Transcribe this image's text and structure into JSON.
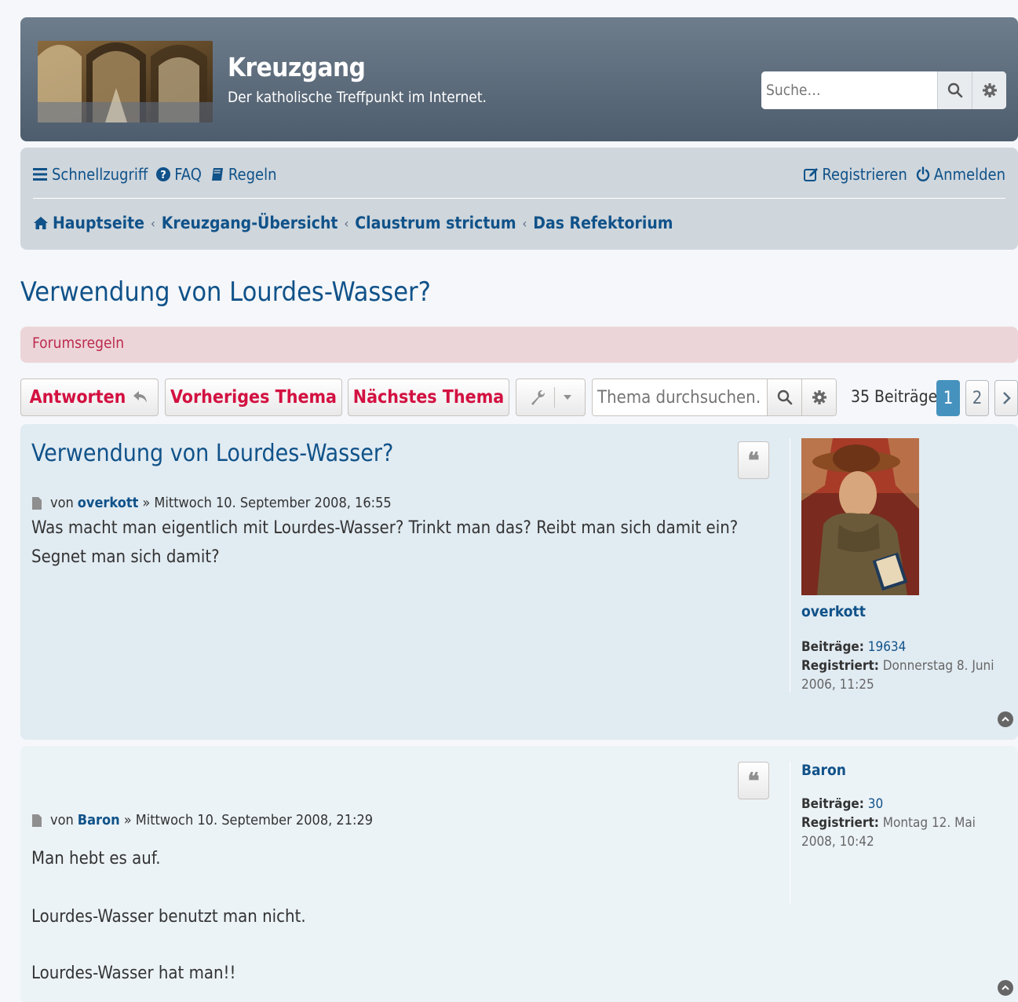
{
  "site": {
    "title": "Kreuzgang",
    "description": "Der katholische Treffpunkt im Internet.",
    "search_placeholder": "Suche…"
  },
  "nav": {
    "quicklinks": "Schnellzugriff",
    "faq": "FAQ",
    "rules": "Regeln",
    "register": "Registrieren",
    "login": "Anmelden"
  },
  "breadcrumbs": [
    "Hauptseite",
    "Kreuzgang-Übersicht",
    "Claustrum strictum",
    "Das Refektorium"
  ],
  "topic": {
    "title": "Verwendung von Lourdes-Wasser?",
    "forum_rules": "Forumsregeln"
  },
  "actions": {
    "reply": "Antworten",
    "prev": "Vorheriges Thema",
    "next": "Nächstes Thema",
    "search_placeholder": "Thema durchsuchen…",
    "post_count": "35 Beiträge",
    "pages": [
      "1",
      "2"
    ]
  },
  "posts": [
    {
      "title": "Verwendung von Lourdes-Wasser?",
      "by": "von",
      "author": "overkott",
      "date": "» Mittwoch 10. September 2008, 16:55",
      "content": "Was macht man eigentlich mit Lourdes-Wasser? Trinkt man das? Reibt man sich damit ein? Segnet man sich damit?",
      "profile": {
        "name": "overkott",
        "posts_label": "Beiträge:",
        "posts": "19634",
        "registered_label": "Registriert:",
        "registered": "Donnerstag 8. Juni 2006, 11:25"
      }
    },
    {
      "by": "von",
      "author": "Baron",
      "date": "» Mittwoch 10. September 2008, 21:29",
      "content": [
        "Man hebt es auf.",
        "Lourdes-Wasser benutzt man nicht.",
        "Lourdes-Wasser hat man!!"
      ],
      "profile": {
        "name": "Baron",
        "posts_label": "Beiträge:",
        "posts": "30",
        "registered_label": "Registriert:",
        "registered": "Montag 12. Mai 2008, 10:42"
      }
    }
  ],
  "colors": {
    "link": "#105289",
    "button_text": "#d31141",
    "header_bg": "#5b6a79",
    "post_bg": "#e1ebf2"
  }
}
